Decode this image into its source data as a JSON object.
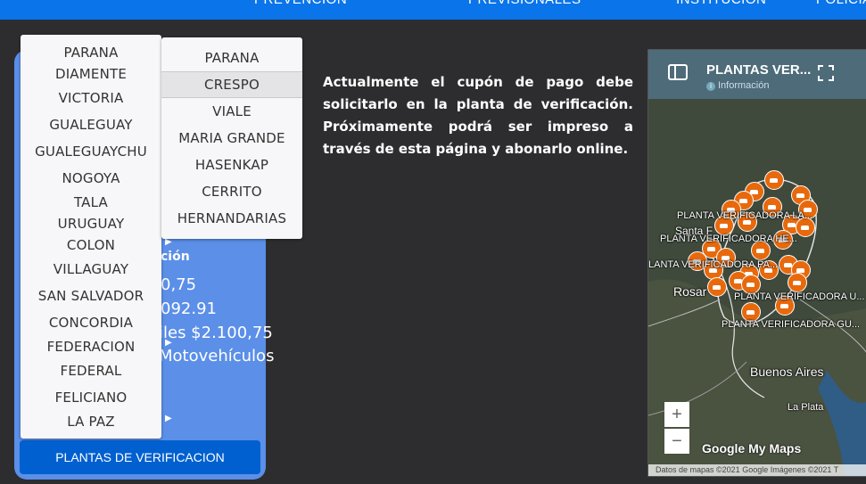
{
  "topnav": [
    "PREVENCION",
    "PREVISIONALES",
    "INSTITUCION",
    "POLICIA"
  ],
  "dropdown_left": [
    "PARANA",
    "DIAMENTE",
    "VICTORIA",
    "GUALEGUAY",
    "GUALEGUAYCHU",
    "NOGOYA",
    "TALA",
    "URUGUAY",
    "COLON",
    "VILLAGUAY",
    "SAN SALVADOR",
    "CONCORDIA",
    "FEDERACION",
    "FEDERAL",
    "FELICIANO",
    "LA PAZ"
  ],
  "dropdown_right": [
    "PARANA",
    "CRESPO",
    "VIALE",
    "MARIA GRANDE",
    "HASENKAP",
    "CERRITO",
    "HERNANDARIAS"
  ],
  "dropdown_right_selected": "CRESPO",
  "panel": {
    "heading_fragment": "ción",
    "line1": "0,75",
    "line2": "092.91",
    "line3": "iles $2.100,75",
    "line4": "Motovehículos"
  },
  "plantas_button": "PLANTAS DE VERIFICACION",
  "paragraph": "Actualmente el cupón de pago debe solicitarlo en la planta de verificación. Próximamente podrá ser impreso a través de esta página y abonarlo online.",
  "map": {
    "title": "PLANTAS VER...",
    "info": "Información",
    "labels": [
      "PLANTA VERIFICADORA LA...",
      "PLANTA VERIFICADORA HE...",
      "LANTA VERIFICADORA PA...",
      "PLANTA VERIFICADORA U...",
      "PLANTA VERIFICADORA GU..."
    ],
    "cities": {
      "santa_fe": "Santa F",
      "rosario": "Rosar",
      "buenos_aires": "Buenos Aires",
      "la_plata": "La Plata"
    },
    "zoom_in": "+",
    "zoom_out": "−",
    "logo": "Google My Maps",
    "attribution": "Datos de mapas ©2021 Google Imágenes ©2021 T"
  }
}
